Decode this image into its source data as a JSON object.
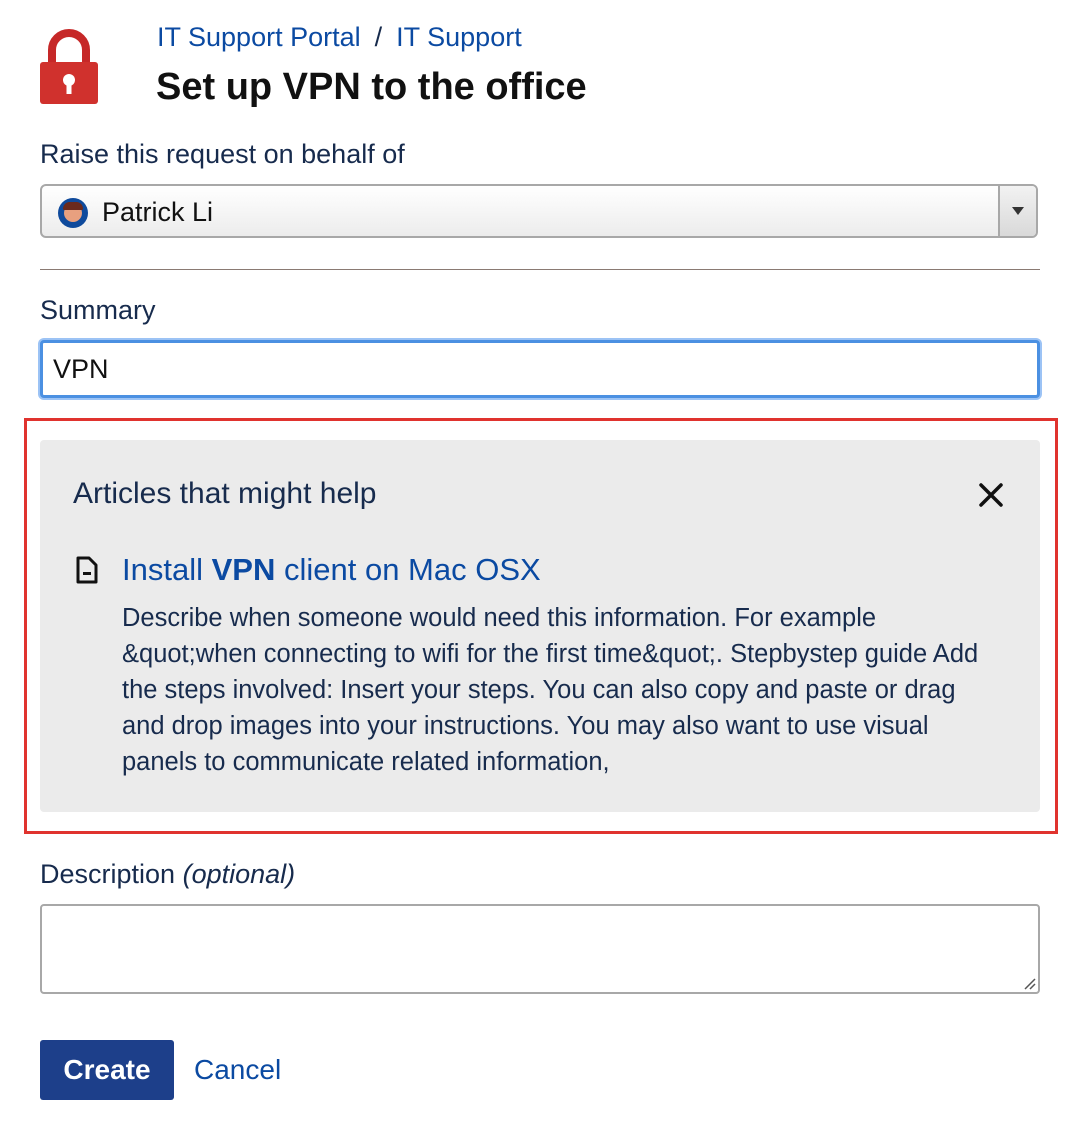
{
  "breadcrumb": {
    "portal": "IT Support Portal",
    "separator": "/",
    "project": "IT Support"
  },
  "page": {
    "title": "Set up VPN to the office"
  },
  "on_behalf": {
    "label": "Raise this request on behalf of",
    "selected": "Patrick Li"
  },
  "summary": {
    "label": "Summary",
    "value": "VPN"
  },
  "articles": {
    "heading": "Articles that might help",
    "close": "×",
    "items": [
      {
        "title_before": "Install ",
        "title_highlight": "VPN",
        "title_after": " client on Mac OSX",
        "excerpt": "Describe when someone would need this information. For example &quot;when connecting to wifi for the first time&quot;. Stepbystep guide Add the steps involved: Insert your steps. You can also copy and paste or drag and drop images into your instructions. You may also want to use visual panels to communicate related information,"
      }
    ]
  },
  "description": {
    "label": "Description",
    "optional": "(optional)",
    "value": ""
  },
  "actions": {
    "create": "Create",
    "cancel": "Cancel"
  },
  "colors": {
    "link": "#0b4aa2",
    "primary_button": "#1d3f8a",
    "highlight_border": "#e0332e",
    "focus": "#4b90e2",
    "lock": "#d0312d"
  },
  "icons": [
    "lock-icon",
    "avatar",
    "chevron-down-icon",
    "close-icon",
    "document-icon"
  ]
}
